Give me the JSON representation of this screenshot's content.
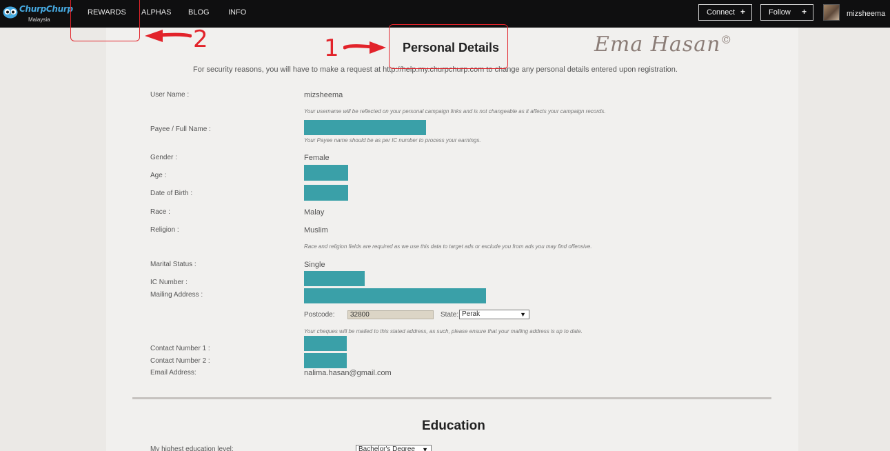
{
  "nav": {
    "logo_text": "ChurpChurp",
    "logo_sub": "Malaysia",
    "links": [
      "REWARDS",
      "ALPHAS",
      "BLOG",
      "INFO"
    ],
    "connect_label": "Connect",
    "follow_label": "Follow",
    "plus": "+",
    "username": "mizsheema"
  },
  "page": {
    "title": "Personal Details",
    "signature": "Ema Hasan",
    "signature_mark": "©",
    "security_note": "For security reasons, you will have to make a request at http://help.my.churpchurp.com to change any personal details entered upon registration."
  },
  "form": {
    "user_name_label": "User Name :",
    "user_name_value": "mizsheema",
    "user_name_hint": "Your username will be reflected on your personal campaign links and is not changeable as it affects your campaign records.",
    "payee_label": "Payee / Full Name :",
    "payee_hint": "Your Payee name should be as per IC number to process your earnings.",
    "gender_label": "Gender :",
    "gender_value": "Female",
    "age_label": "Age :",
    "dob_label": "Date of Birth :",
    "race_label": "Race :",
    "race_value": "Malay",
    "religion_label": "Religion :",
    "religion_value": "Muslim",
    "race_religion_hint": "Race and religion fields are required as we use this data to target ads or exclude you from ads you may find offensive.",
    "marital_label": "Marital Status :",
    "marital_value": "Single",
    "ic_label": "IC Number :",
    "mailing_label": "Mailing Address :",
    "postcode_label": "Postcode:",
    "postcode_value": "32800",
    "state_label": "State:",
    "state_value": "Perak",
    "mailing_hint": "Your cheques will be mailed to this stated address, as such, please ensure that your mailing address is up to date.",
    "contact1_label": "Contact Number 1 :",
    "contact2_label": "Contact Number 2 :",
    "email_label": "Email Address:",
    "email_value": "nalima.hasan@gmail.com"
  },
  "education": {
    "title": "Education",
    "level_label": "My highest education level:",
    "level_value": "Bachelor's Degree"
  },
  "annotations": {
    "one": "1",
    "two": "2"
  },
  "colors": {
    "redaction": "#3aa0a8",
    "annotation": "#e2232a",
    "nav_bg": "#0f0f10",
    "page_bg": "#ebe9e6"
  }
}
